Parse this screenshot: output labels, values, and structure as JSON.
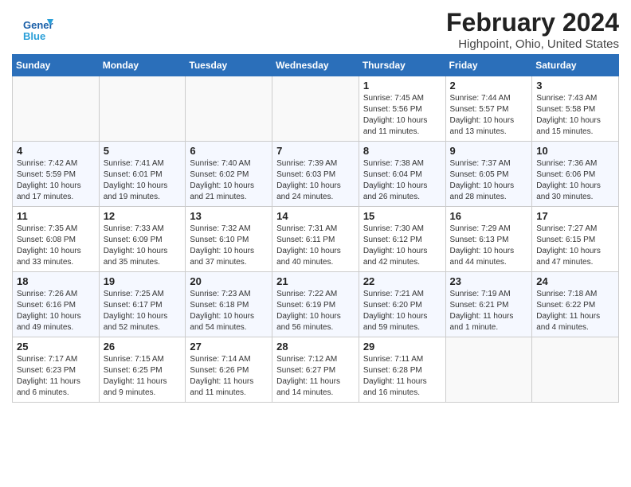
{
  "logo": {
    "line1": "General",
    "line2": "Blue"
  },
  "header": {
    "title": "February 2024",
    "subtitle": "Highpoint, Ohio, United States"
  },
  "weekdays": [
    "Sunday",
    "Monday",
    "Tuesday",
    "Wednesday",
    "Thursday",
    "Friday",
    "Saturday"
  ],
  "weeks": [
    [
      {
        "day": "",
        "info": ""
      },
      {
        "day": "",
        "info": ""
      },
      {
        "day": "",
        "info": ""
      },
      {
        "day": "",
        "info": ""
      },
      {
        "day": "1",
        "info": "Sunrise: 7:45 AM\nSunset: 5:56 PM\nDaylight: 10 hours\nand 11 minutes."
      },
      {
        "day": "2",
        "info": "Sunrise: 7:44 AM\nSunset: 5:57 PM\nDaylight: 10 hours\nand 13 minutes."
      },
      {
        "day": "3",
        "info": "Sunrise: 7:43 AM\nSunset: 5:58 PM\nDaylight: 10 hours\nand 15 minutes."
      }
    ],
    [
      {
        "day": "4",
        "info": "Sunrise: 7:42 AM\nSunset: 5:59 PM\nDaylight: 10 hours\nand 17 minutes."
      },
      {
        "day": "5",
        "info": "Sunrise: 7:41 AM\nSunset: 6:01 PM\nDaylight: 10 hours\nand 19 minutes."
      },
      {
        "day": "6",
        "info": "Sunrise: 7:40 AM\nSunset: 6:02 PM\nDaylight: 10 hours\nand 21 minutes."
      },
      {
        "day": "7",
        "info": "Sunrise: 7:39 AM\nSunset: 6:03 PM\nDaylight: 10 hours\nand 24 minutes."
      },
      {
        "day": "8",
        "info": "Sunrise: 7:38 AM\nSunset: 6:04 PM\nDaylight: 10 hours\nand 26 minutes."
      },
      {
        "day": "9",
        "info": "Sunrise: 7:37 AM\nSunset: 6:05 PM\nDaylight: 10 hours\nand 28 minutes."
      },
      {
        "day": "10",
        "info": "Sunrise: 7:36 AM\nSunset: 6:06 PM\nDaylight: 10 hours\nand 30 minutes."
      }
    ],
    [
      {
        "day": "11",
        "info": "Sunrise: 7:35 AM\nSunset: 6:08 PM\nDaylight: 10 hours\nand 33 minutes."
      },
      {
        "day": "12",
        "info": "Sunrise: 7:33 AM\nSunset: 6:09 PM\nDaylight: 10 hours\nand 35 minutes."
      },
      {
        "day": "13",
        "info": "Sunrise: 7:32 AM\nSunset: 6:10 PM\nDaylight: 10 hours\nand 37 minutes."
      },
      {
        "day": "14",
        "info": "Sunrise: 7:31 AM\nSunset: 6:11 PM\nDaylight: 10 hours\nand 40 minutes."
      },
      {
        "day": "15",
        "info": "Sunrise: 7:30 AM\nSunset: 6:12 PM\nDaylight: 10 hours\nand 42 minutes."
      },
      {
        "day": "16",
        "info": "Sunrise: 7:29 AM\nSunset: 6:13 PM\nDaylight: 10 hours\nand 44 minutes."
      },
      {
        "day": "17",
        "info": "Sunrise: 7:27 AM\nSunset: 6:15 PM\nDaylight: 10 hours\nand 47 minutes."
      }
    ],
    [
      {
        "day": "18",
        "info": "Sunrise: 7:26 AM\nSunset: 6:16 PM\nDaylight: 10 hours\nand 49 minutes."
      },
      {
        "day": "19",
        "info": "Sunrise: 7:25 AM\nSunset: 6:17 PM\nDaylight: 10 hours\nand 52 minutes."
      },
      {
        "day": "20",
        "info": "Sunrise: 7:23 AM\nSunset: 6:18 PM\nDaylight: 10 hours\nand 54 minutes."
      },
      {
        "day": "21",
        "info": "Sunrise: 7:22 AM\nSunset: 6:19 PM\nDaylight: 10 hours\nand 56 minutes."
      },
      {
        "day": "22",
        "info": "Sunrise: 7:21 AM\nSunset: 6:20 PM\nDaylight: 10 hours\nand 59 minutes."
      },
      {
        "day": "23",
        "info": "Sunrise: 7:19 AM\nSunset: 6:21 PM\nDaylight: 11 hours\nand 1 minute."
      },
      {
        "day": "24",
        "info": "Sunrise: 7:18 AM\nSunset: 6:22 PM\nDaylight: 11 hours\nand 4 minutes."
      }
    ],
    [
      {
        "day": "25",
        "info": "Sunrise: 7:17 AM\nSunset: 6:23 PM\nDaylight: 11 hours\nand 6 minutes."
      },
      {
        "day": "26",
        "info": "Sunrise: 7:15 AM\nSunset: 6:25 PM\nDaylight: 11 hours\nand 9 minutes."
      },
      {
        "day": "27",
        "info": "Sunrise: 7:14 AM\nSunset: 6:26 PM\nDaylight: 11 hours\nand 11 minutes."
      },
      {
        "day": "28",
        "info": "Sunrise: 7:12 AM\nSunset: 6:27 PM\nDaylight: 11 hours\nand 14 minutes."
      },
      {
        "day": "29",
        "info": "Sunrise: 7:11 AM\nSunset: 6:28 PM\nDaylight: 11 hours\nand 16 minutes."
      },
      {
        "day": "",
        "info": ""
      },
      {
        "day": "",
        "info": ""
      }
    ]
  ]
}
